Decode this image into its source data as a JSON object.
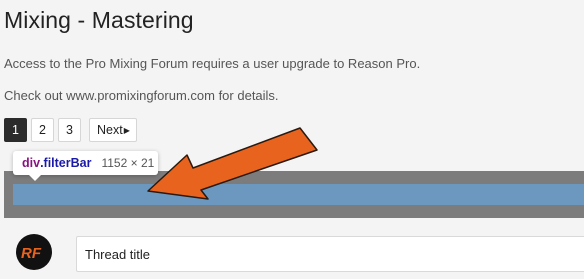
{
  "page": {
    "title": "Mixing - Mastering",
    "notice_upgrade": "Access to the Pro Mixing Forum requires a user upgrade to Reason Pro.",
    "notice_details": "Check out www.promixingforum.com for details."
  },
  "pagination": {
    "pages": [
      "1",
      "2",
      "3"
    ],
    "active_page": "1",
    "next_label": "Next"
  },
  "inspector_tooltip": {
    "tag": "div",
    "class": ".filterBar",
    "size": "1152 × 21"
  },
  "thread_form": {
    "title_placeholder": "Thread title",
    "avatar_initials": "RF"
  },
  "colors": {
    "highlight_margin": "#7c7c7c",
    "highlight_content": "#6c98c0",
    "annotation_arrow": "#e8641e"
  },
  "icons": {
    "next": "triangle-right-icon",
    "annotation": "arrow-icon"
  }
}
